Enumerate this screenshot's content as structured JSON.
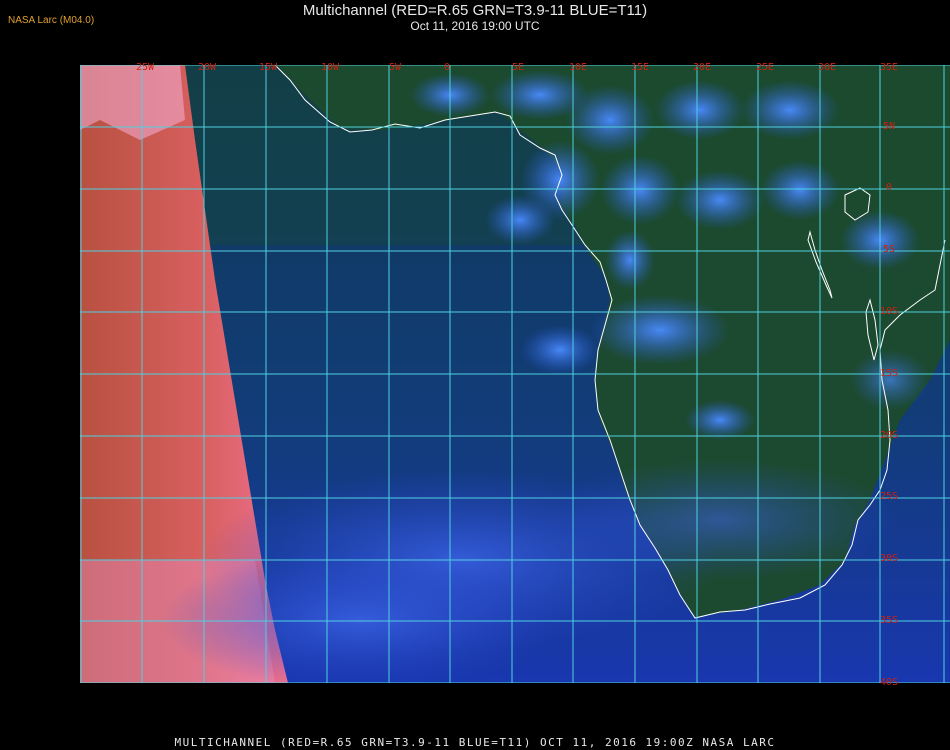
{
  "header": {
    "title": "Multichannel (RED=R.65 GRN=T3.9-11 BLUE=T11)",
    "datetime": "Oct 11, 2016 19:00 UTC",
    "credit": "NASA Larc (M04.0)"
  },
  "footer": {
    "caption": "MULTICHANNEL (RED=R.65 GRN=T3.9-11 BLUE=T11) OCT 11, 2016 19:00Z   NASA LARC"
  },
  "map": {
    "longitude_labels": [
      "25W",
      "20W",
      "15W",
      "10W",
      "5W",
      "0",
      "5E",
      "10E",
      "15E",
      "20E",
      "25E",
      "30E",
      "35E"
    ],
    "latitude_labels": [
      "5N",
      "0",
      "5S",
      "10S",
      "15S",
      "20S",
      "25S",
      "30S",
      "35S",
      "40S"
    ],
    "grid_color": "#4fd0e0",
    "label_color": "#d02010",
    "coast_color": "#ffffff"
  }
}
